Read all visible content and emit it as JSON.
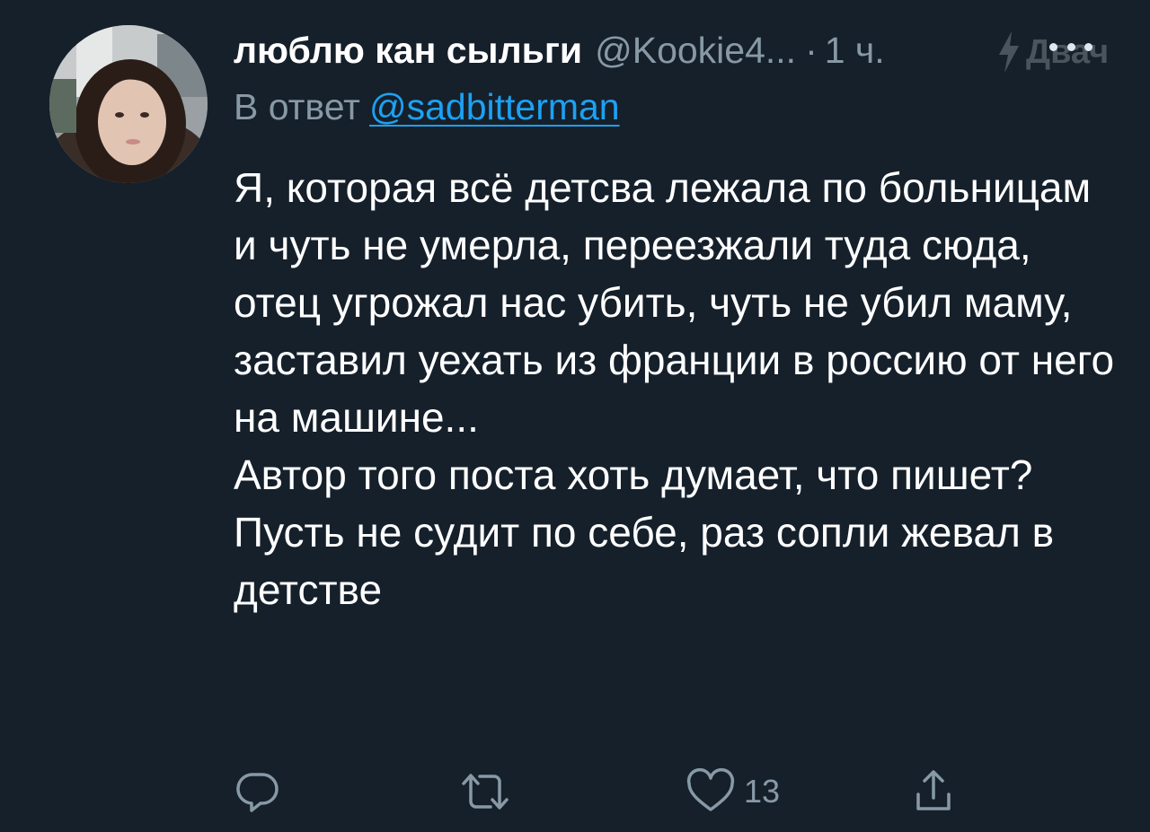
{
  "tweet": {
    "author": {
      "display_name": "люблю кан сыльги",
      "handle": "@Kookie4...",
      "separator": "·",
      "time": "1 ч."
    },
    "reply": {
      "prefix": "В ответ",
      "mention": "@sadbitterman"
    },
    "body": {
      "paragraph_1": "Я, которая всё детсва лежала по больницам и чуть не умерла, переезжали туда сюда, отец угрожал нас убить, чуть не убил маму, заставил уехать из франции в россию от него на машине...",
      "paragraph_2": "Автор того поста хоть думает, что пишет?",
      "paragraph_3": "Пусть не судит по себе, раз сопли жевал в детстве"
    },
    "actions": {
      "reply_icon": "reply-icon",
      "retweet_icon": "retweet-icon",
      "like_icon": "heart-icon",
      "like_count": "13",
      "share_icon": "share-icon"
    }
  },
  "watermark": {
    "text": "Двач"
  },
  "colors": {
    "background": "#15202b",
    "text_primary": "#ffffff",
    "text_secondary": "#8899a6",
    "link": "#1da1f2"
  }
}
